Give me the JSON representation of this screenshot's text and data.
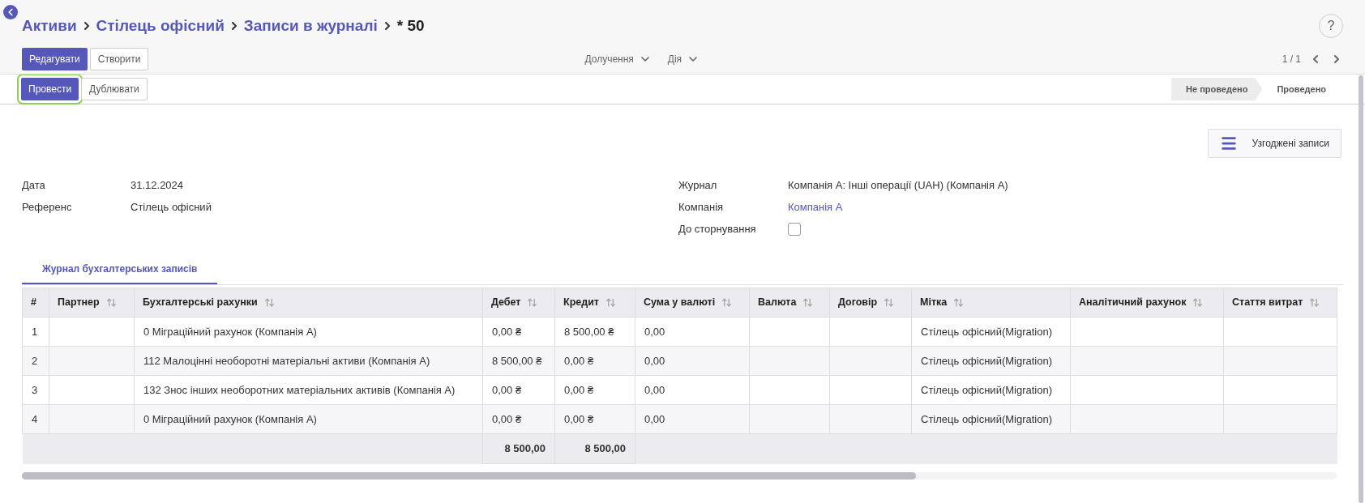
{
  "breadcrumbs": [
    {
      "label": "Активи",
      "link": true
    },
    {
      "label": "Стілець офісний",
      "link": true
    },
    {
      "label": "Записи в журналі",
      "link": true
    },
    {
      "label": "* 50",
      "link": false
    }
  ],
  "help": "?",
  "buttons": [
    {
      "label": "Редагувати",
      "primary": true
    },
    {
      "label": "Створити",
      "primary": false
    }
  ],
  "menus": [
    "Долучення",
    "Дія"
  ],
  "pager": "1 / 1",
  "actions": [
    {
      "label": "Провести",
      "primary": true,
      "highlighted": true
    },
    {
      "label": "Дублювати",
      "primary": false,
      "highlighted": false
    }
  ],
  "stages": [
    {
      "label": "Не проведено",
      "selected": true
    },
    {
      "label": "Проведено",
      "selected": false
    }
  ],
  "smart_button": "Узгоджені записи",
  "fields_left": [
    {
      "label": "Дата",
      "value": "31.12.2024"
    },
    {
      "label": "Референс",
      "value": "Стілець офісний"
    }
  ],
  "fields_right": [
    {
      "kind": "text",
      "label": "Журнал",
      "value": "Компанія А: Інші операції (UAH) (Компанія А)"
    },
    {
      "kind": "link",
      "label": "Компанія",
      "value": "Компанія А"
    },
    {
      "kind": "checkbox",
      "label": "До сторнування",
      "checked": false
    }
  ],
  "tabs": [
    {
      "label": "Журнал бухгалтерських записів",
      "selected": true
    }
  ],
  "table": {
    "columns": [
      {
        "label": "#",
        "sortable": false
      },
      {
        "label": "Партнер",
        "sortable": true
      },
      {
        "label": "Бухгалтерські рахунки",
        "sortable": true
      },
      {
        "label": "Дебет",
        "sortable": true
      },
      {
        "label": "Кредит",
        "sortable": true
      },
      {
        "label": "Сума у валюті",
        "sortable": true
      },
      {
        "label": "Валюта",
        "sortable": true
      },
      {
        "label": "Договір",
        "sortable": true
      },
      {
        "label": "Мітка",
        "sortable": true
      },
      {
        "label": "Аналітичний рахунок",
        "sortable": true
      },
      {
        "label": "Стаття витрат",
        "sortable": true
      }
    ],
    "rows": [
      [
        "1",
        "",
        "0 Міграційний рахунок (Компанія А)",
        "0,00 ₴",
        "8 500,00 ₴",
        "0,00",
        "",
        "",
        "Стілець офісний(Migration)",
        "",
        ""
      ],
      [
        "2",
        "",
        "112 Малоцінні необоротні матеріальні активи (Компанія А)",
        "8 500,00 ₴",
        "0,00 ₴",
        "0,00",
        "",
        "",
        "Стілець офісний(Migration)",
        "",
        ""
      ],
      [
        "3",
        "",
        "132 Знос інших необоротних матеріальних активів (Компанія А)",
        "0,00 ₴",
        "0,00 ₴",
        "0,00",
        "",
        "",
        "Стілець офісний(Migration)",
        "",
        ""
      ],
      [
        "4",
        "",
        "0 Міграційний рахунок (Компанія А)",
        "0,00 ₴",
        "0,00 ₴",
        "0,00",
        "",
        "",
        "Стілець офісний(Migration)",
        "",
        ""
      ]
    ],
    "totals": {
      "debit": "8 500,00",
      "credit": "8 500,00"
    }
  }
}
